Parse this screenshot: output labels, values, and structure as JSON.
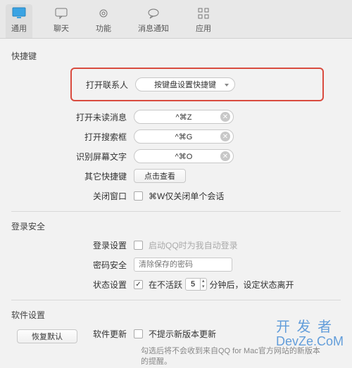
{
  "toolbar": {
    "tabs": [
      {
        "label": "通用",
        "icon": "monitor-icon",
        "active": true
      },
      {
        "label": "聊天",
        "icon": "chat-bubble-icon"
      },
      {
        "label": "功能",
        "icon": "gear-icon"
      },
      {
        "label": "消息通知",
        "icon": "speech-icon"
      },
      {
        "label": "应用",
        "icon": "grid-icon"
      }
    ]
  },
  "sections": {
    "shortcuts": {
      "title": "快捷键",
      "open_contacts": {
        "label": "打开联系人",
        "value": "按键盘设置快捷键"
      },
      "unread": {
        "label": "打开未读消息",
        "value": "^⌘Z"
      },
      "search": {
        "label": "打开搜索框",
        "value": "^⌘G"
      },
      "ocr": {
        "label": "识别屏幕文字",
        "value": "^⌘O"
      },
      "others": {
        "label": "其它快捷键",
        "button": "点击查看"
      },
      "close_window": {
        "label": "关闭窗口",
        "checkbox": "⌘W仅关闭单个会话",
        "checked": false
      }
    },
    "login": {
      "title": "登录安全",
      "login_setting": {
        "label": "登录设置",
        "checkbox": "启动QQ时为我自动登录",
        "checked": false
      },
      "password": {
        "label": "密码安全",
        "placeholder": "清除保存的密码"
      },
      "status": {
        "label": "状态设置",
        "prefix": "在不活跃",
        "value": "5",
        "suffix": "分钟后，设定状态离开",
        "checked": true
      }
    },
    "software": {
      "title": "软件设置",
      "update": {
        "label": "软件更新",
        "checkbox": "不提示新版本更新",
        "checked": false,
        "hint": "勾选后将不会收到来自QQ for Mac官方网站的新版本的提醒。"
      }
    }
  },
  "footer": {
    "restore": "恢复默认"
  },
  "watermark": {
    "line1": "开 发 者",
    "line2": "DevZe.CoM"
  }
}
